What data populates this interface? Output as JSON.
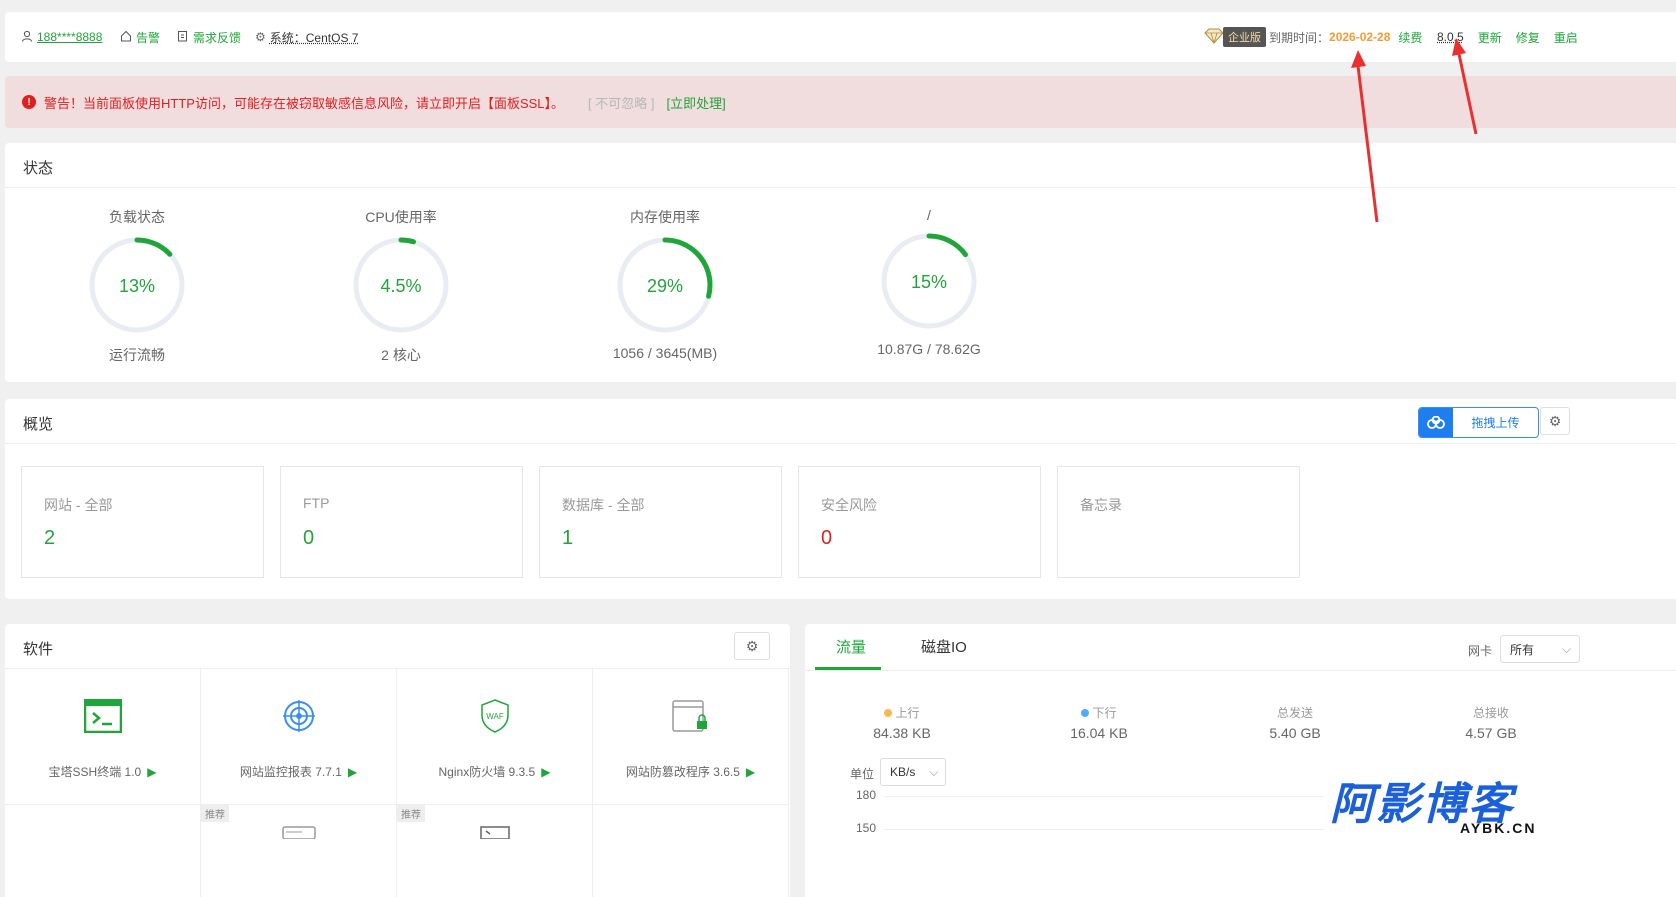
{
  "topbar": {
    "user": "188****8888",
    "alarm": "告警",
    "feedback": "需求反馈",
    "system": "系统：CentOS 7",
    "edition": "企业版",
    "expire_label": "到期时间：",
    "expire_date": "2026-02-28",
    "renew": "续费",
    "version": "8.0.5",
    "update": "更新",
    "repair": "修复",
    "restart": "重启"
  },
  "alert": {
    "icon": "!",
    "message": "警告！当前面板使用HTTP访问，可能存在被窃取敏感信息风险，请立即开启【面板SSL】。",
    "ignore": "[ 不可忽略 ]",
    "handle": "[立即处理]"
  },
  "status": {
    "title": "状态",
    "gauges": [
      {
        "label": "负载状态",
        "value": "13%",
        "sub": "运行流畅",
        "percent": 13
      },
      {
        "label": "CPU使用率",
        "value": "4.5%",
        "sub": "2 核心",
        "percent": 4.5
      },
      {
        "label": "内存使用率",
        "value": "29%",
        "sub": "1056 / 3645(MB)",
        "percent": 29
      },
      {
        "label": "/",
        "value": "15%",
        "sub": "10.87G / 78.62G",
        "percent": 15
      }
    ]
  },
  "overview": {
    "title": "概览",
    "upload": "拖拽上传",
    "cards": [
      {
        "title": "网站 - 全部",
        "value": "2"
      },
      {
        "title": "FTP",
        "value": "0"
      },
      {
        "title": "数据库 - 全部",
        "value": "1"
      },
      {
        "title": "安全风险",
        "value": "0"
      },
      {
        "title": "备忘录",
        "value": ""
      }
    ]
  },
  "software": {
    "title": "软件",
    "items": [
      {
        "label": "宝塔SSH终端 1.0",
        "icon": "terminal-icon"
      },
      {
        "label": "网站监控报表 7.7.1",
        "icon": "target-icon"
      },
      {
        "label": "Nginx防火墙 9.3.5",
        "icon": "waf-shield-icon"
      },
      {
        "label": "网站防篡改程序 3.6.5",
        "icon": "lock-window-icon"
      }
    ],
    "tag": "推荐"
  },
  "traffic": {
    "tabs": [
      "流量",
      "磁盘IO"
    ],
    "nic_label": "网卡",
    "nic_value": "所有",
    "stats": [
      {
        "label": "上行",
        "value": "84.38 KB",
        "color": "#f7b851"
      },
      {
        "label": "下行",
        "value": "16.04 KB",
        "color": "#52a9ff"
      },
      {
        "label": "总发送",
        "value": "5.40 GB"
      },
      {
        "label": "总接收",
        "value": "4.57 GB"
      }
    ],
    "unit_label": "单位",
    "unit_value": "KB/s",
    "y_ticks": [
      "180",
      "150"
    ]
  },
  "watermark": {
    "main": "阿影博客",
    "sub": "AYBK.CN"
  },
  "colors": {
    "accent": "#20a53a",
    "danger": "#e02020",
    "expire": "#f39b36",
    "upload": "#1e7ef0"
  }
}
